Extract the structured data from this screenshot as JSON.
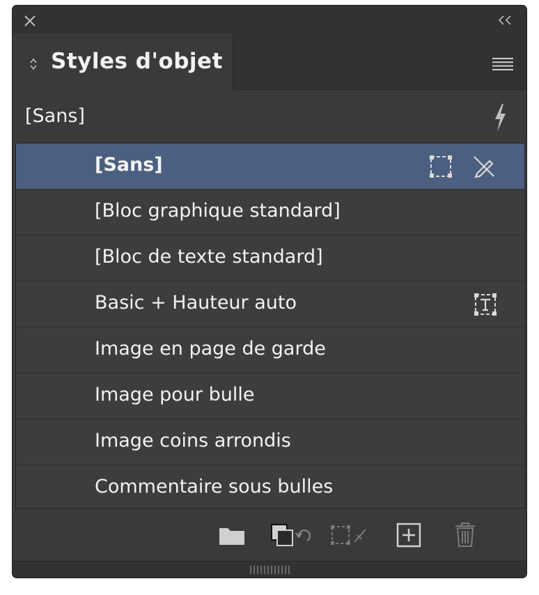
{
  "panel": {
    "title": "Styles d'objet",
    "current_style": "[Sans]"
  },
  "styles": [
    {
      "label": "[Sans]",
      "selected": true,
      "icons": [
        "frame-icon",
        "no-edit-pencil-icon"
      ]
    },
    {
      "label": "[Bloc graphique standard]",
      "selected": false,
      "icons": []
    },
    {
      "label": "[Bloc de texte standard]",
      "selected": false,
      "icons": []
    },
    {
      "label": "Basic + Hauteur auto",
      "selected": false,
      "icons": [
        "text-frame-icon"
      ]
    },
    {
      "label": "Image en page de garde",
      "selected": false,
      "icons": []
    },
    {
      "label": "Image pour bulle",
      "selected": false,
      "icons": []
    },
    {
      "label": "Image coins arrondis",
      "selected": false,
      "icons": []
    },
    {
      "label": "Commentaire sous bulles",
      "selected": false,
      "icons": []
    }
  ],
  "bottom_bar": {
    "icons": [
      "folder-icon",
      "clear-overrides-icon",
      "clear-non-defined-attributes-icon",
      "new-style-icon",
      "delete-icon"
    ]
  },
  "colors": {
    "panel_bg": "#3a3a3a",
    "selected_row": "#4b6080",
    "text": "#f2f2f2"
  }
}
